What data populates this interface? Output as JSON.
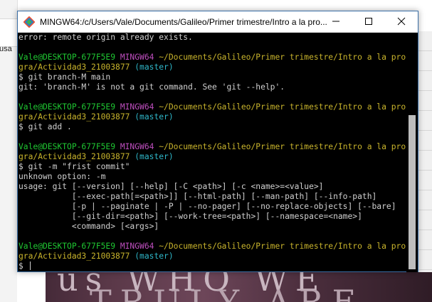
{
  "background": {
    "partial_text": "usa",
    "image_text_line1": "us WHO WE",
    "image_text_line2": "TRULY ARE"
  },
  "window": {
    "title": "MINGW64:/c/Users/Vale/Documents/Galileo/Primer trimestre/Intro a la pro...",
    "icon": "git-bash-icon",
    "controls": [
      "minimize-icon",
      "maximize-icon",
      "close-icon"
    ]
  },
  "terminal": {
    "lines": [
      {
        "segments": [
          {
            "text": "error: remote origin already exists.",
            "color": "white"
          }
        ]
      },
      {
        "segments": [
          {
            "text": "",
            "color": "white"
          }
        ]
      },
      {
        "segments": [
          {
            "text": "Vale@DESKTOP-677F5E9 ",
            "color": "green"
          },
          {
            "text": "MINGW64 ",
            "color": "purple"
          },
          {
            "text": "~/Documents/Galileo/Primer trimestre/Intro a la pro",
            "color": "yellow"
          }
        ]
      },
      {
        "segments": [
          {
            "text": "gra/Actividad3_21003877",
            "color": "yellow"
          },
          {
            "text": " (master)",
            "color": "cyan"
          }
        ]
      },
      {
        "segments": [
          {
            "text": "$ git branch-M main",
            "color": "white"
          }
        ]
      },
      {
        "segments": [
          {
            "text": "git: 'branch-M' is not a git command. See 'git --help'.",
            "color": "white"
          }
        ]
      },
      {
        "segments": [
          {
            "text": "",
            "color": "white"
          }
        ]
      },
      {
        "segments": [
          {
            "text": "Vale@DESKTOP-677F5E9 ",
            "color": "green"
          },
          {
            "text": "MINGW64 ",
            "color": "purple"
          },
          {
            "text": "~/Documents/Galileo/Primer trimestre/Intro a la pro",
            "color": "yellow"
          }
        ]
      },
      {
        "segments": [
          {
            "text": "gra/Actividad3_21003877",
            "color": "yellow"
          },
          {
            "text": " (master)",
            "color": "cyan"
          }
        ]
      },
      {
        "segments": [
          {
            "text": "$ git add .",
            "color": "white"
          }
        ]
      },
      {
        "segments": [
          {
            "text": "",
            "color": "white"
          }
        ]
      },
      {
        "segments": [
          {
            "text": "Vale@DESKTOP-677F5E9 ",
            "color": "green"
          },
          {
            "text": "MINGW64 ",
            "color": "purple"
          },
          {
            "text": "~/Documents/Galileo/Primer trimestre/Intro a la pro",
            "color": "yellow"
          }
        ]
      },
      {
        "segments": [
          {
            "text": "gra/Actividad3_21003877",
            "color": "yellow"
          },
          {
            "text": " (master)",
            "color": "cyan"
          }
        ]
      },
      {
        "segments": [
          {
            "text": "$ git -m \"frist commit\"",
            "color": "white"
          }
        ]
      },
      {
        "segments": [
          {
            "text": "unknown option: -m",
            "color": "white"
          }
        ]
      },
      {
        "segments": [
          {
            "text": "usage: git [--version] [--help] [-C <path>] [-c <name>=<value>]",
            "color": "white"
          }
        ]
      },
      {
        "segments": [
          {
            "text": "           [--exec-path[=<path>]] [--html-path] [--man-path] [--info-path]",
            "color": "white"
          }
        ]
      },
      {
        "segments": [
          {
            "text": "           [-p | --paginate | -P | --no-pager] [--no-replace-objects] [--bare]",
            "color": "white"
          }
        ]
      },
      {
        "segments": [
          {
            "text": "           [--git-dir=<path>] [--work-tree=<path>] [--namespace=<name>]",
            "color": "white"
          }
        ]
      },
      {
        "segments": [
          {
            "text": "           <command> [<args>]",
            "color": "white"
          }
        ]
      },
      {
        "segments": [
          {
            "text": "",
            "color": "white"
          }
        ]
      },
      {
        "segments": [
          {
            "text": "Vale@DESKTOP-677F5E9 ",
            "color": "green"
          },
          {
            "text": "MINGW64 ",
            "color": "purple"
          },
          {
            "text": "~/Documents/Galileo/Primer trimestre/Intro a la pro",
            "color": "yellow"
          }
        ]
      },
      {
        "segments": [
          {
            "text": "gra/Actividad3_21003877",
            "color": "yellow"
          },
          {
            "text": " (master)",
            "color": "cyan"
          }
        ]
      },
      {
        "segments": [
          {
            "text": "$ ",
            "color": "white"
          }
        ],
        "cursor": true
      }
    ]
  },
  "colors": {
    "green": "#1fc832",
    "purple": "#c04fc0",
    "yellow": "#c9b42c",
    "cyan": "#2fb7c9",
    "white": "#d0d0d0",
    "terminal_bg": "#000000"
  }
}
